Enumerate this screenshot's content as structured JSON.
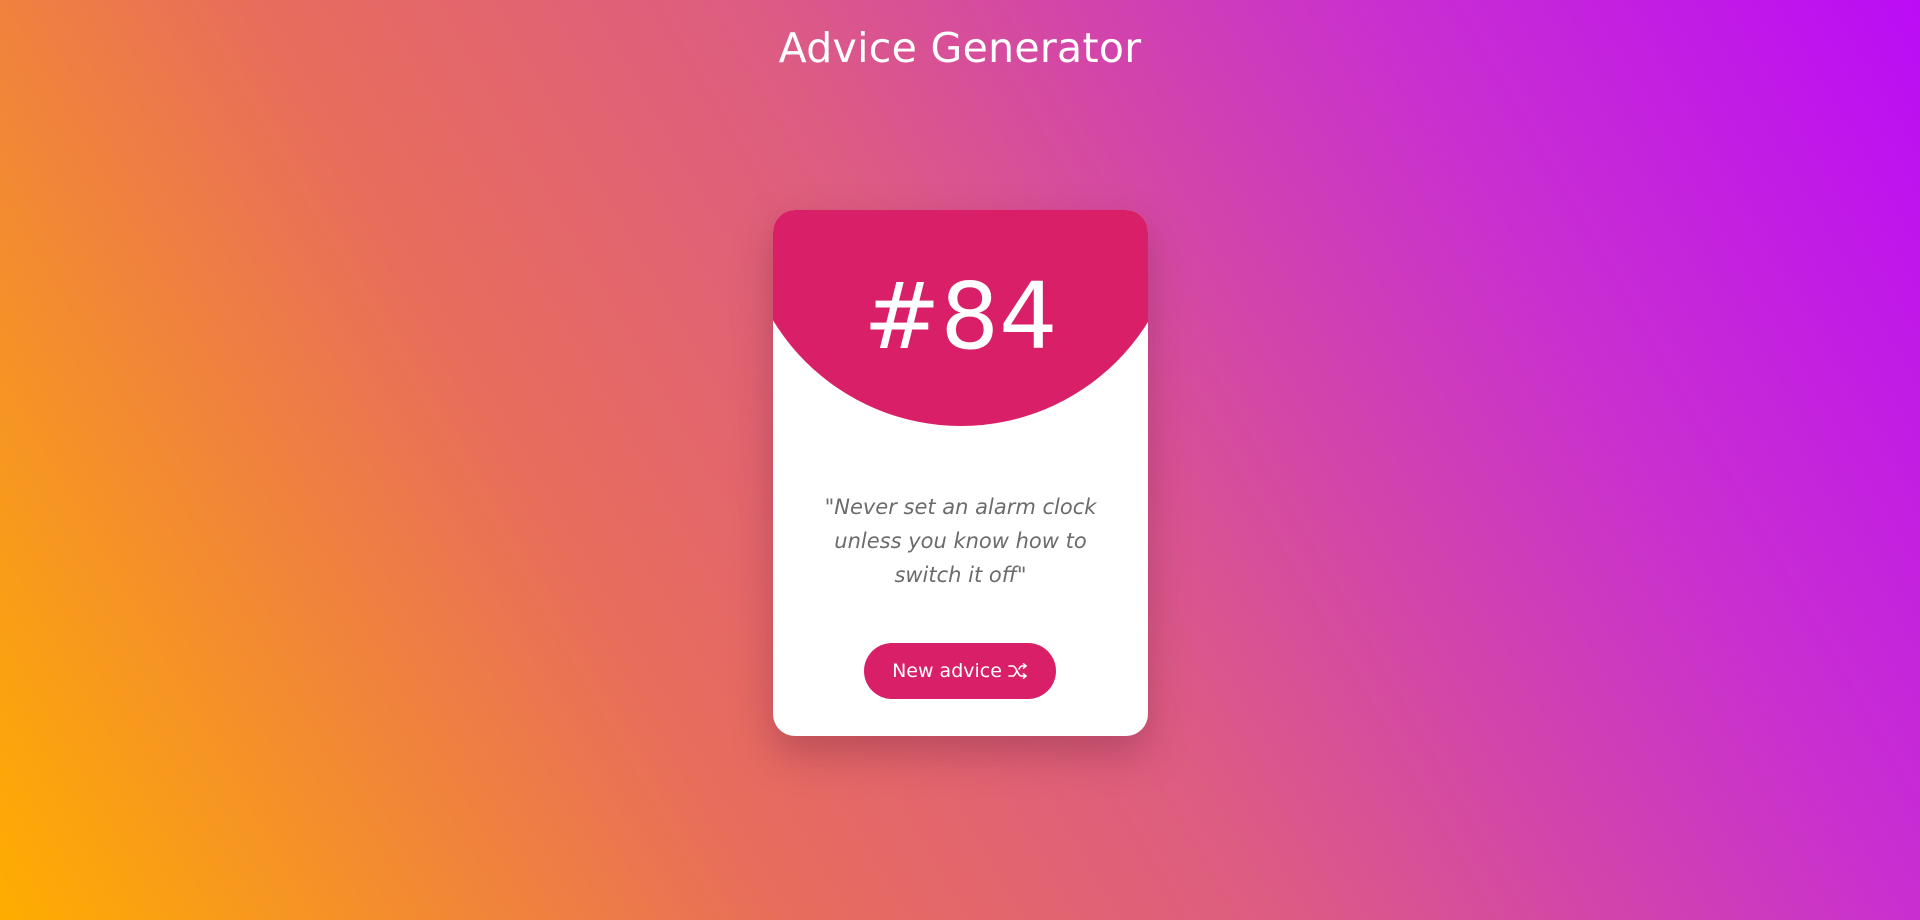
{
  "header": {
    "title": "Advice Generator"
  },
  "card": {
    "advice_number": "#84",
    "advice_text": "\"Never set an alarm clock unless you know how to switch it off\"",
    "button_label": "New advice",
    "button_icon": "shuffle-icon"
  },
  "colors": {
    "accent": "#d91f67",
    "card_background": "#ffffff",
    "gradient_start": "#ffad00",
    "gradient_end": "#bb0cf6",
    "advice_text": "#6b6b6b"
  }
}
